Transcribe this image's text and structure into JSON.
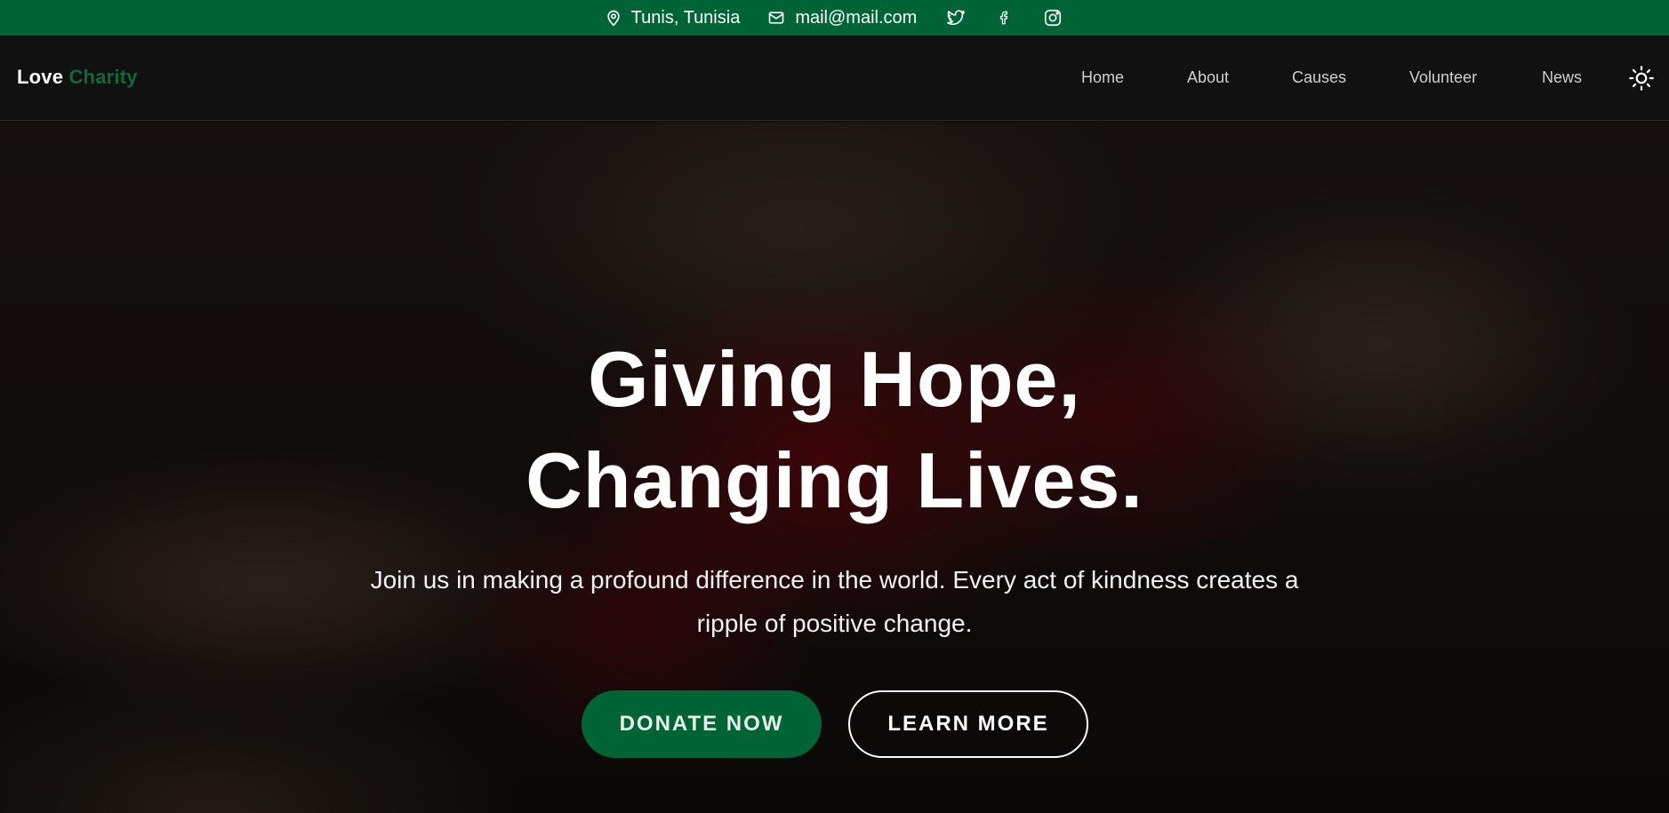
{
  "topbar": {
    "location": "Tunis, Tunisia",
    "email": "mail@mail.com",
    "icons": [
      "location-pin-icon",
      "mail-icon",
      "twitter-icon",
      "facebook-icon",
      "instagram-icon"
    ],
    "background": "#006437"
  },
  "navbar": {
    "brand_word1": "Love",
    "brand_word2": "Charity",
    "links": [
      "Home",
      "About",
      "Causes",
      "Volunteer",
      "News"
    ],
    "theme_toggle_icon": "sun-icon",
    "background": "#111111"
  },
  "hero": {
    "title_line1": "Giving Hope,",
    "title_line2": "Changing Lives.",
    "subtitle": "Join us in making a profound difference in the world. Every act of kindness creates a ripple of positive change.",
    "primary_button": "DONATE NOW",
    "secondary_button": "LEARN MORE",
    "accent": "#006437"
  }
}
